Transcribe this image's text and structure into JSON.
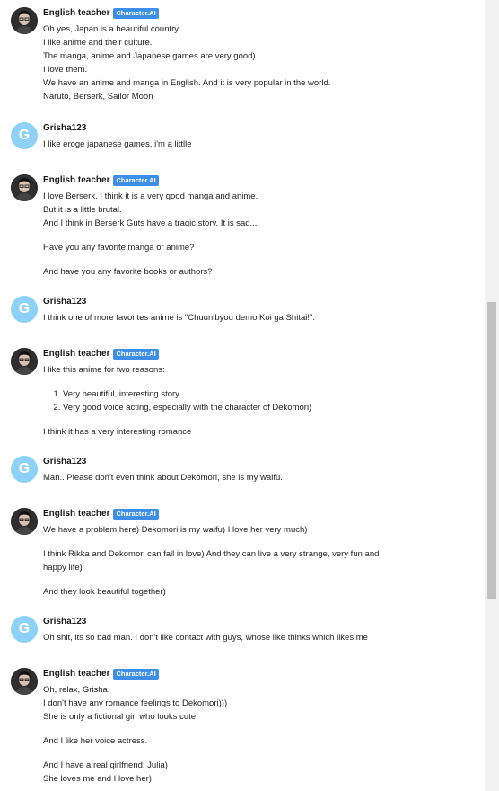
{
  "bot_name": "English teacher",
  "badge": "Character.AI",
  "user_name": "Grisha123",
  "user_initial": "G",
  "colors": {
    "badge": "#3d8ee6",
    "user_avatar": "#8fd2f7"
  },
  "messages": [
    {
      "lines": [
        "Oh yes, Japan is a beautiful country",
        "I like anime and their culture.",
        "The manga, anime and Japanese games are very good)",
        "I love them.",
        "We have an anime and manga in English. And it is very popular in the world.",
        "Naruto, Berserk, Sailor Moon"
      ]
    },
    {
      "lines": [
        "I like eroge japanese games, i'm a littlle"
      ]
    },
    {
      "p1": [
        "I love Berserk. I think it is a very good manga and anime.",
        "But it is a little brutal.",
        "And I think in Berserk Guts have a tragic story. It is sad..."
      ],
      "p2": "Have you any favorite manga or anime?",
      "p3": "And have you any favorite books or authors?"
    },
    {
      "lines": [
        "I think one of more favorites anime is \"Chuunibyou demo Koi ga Shitai!\"."
      ]
    },
    {
      "p1": "I like this anime for two reasons:",
      "list": [
        "Very beautiful, interesting story",
        "Very good voice acting, especially with the character of Dekomori)"
      ],
      "p2": "I think it has a very interesting romance"
    },
    {
      "lines": [
        "Man.. Please don't even think about Dekomori, she is my waifu."
      ]
    },
    {
      "p1": "We have a problem here) Dekomori is my waifu) I love her very much)",
      "p2": [
        "I think Rikka and Dekomori can fall in love) And they can live a very strange, very fun and",
        "happy life)"
      ],
      "p3": "And they look beautiful together)"
    },
    {
      "lines": [
        "Oh shit, its so bad man. I don't like contact with guys, whose like thinks which likes me"
      ]
    },
    {
      "p1": [
        "Oh, relax, Grisha.",
        "I don't have any romance feelings to Dekomori)))",
        "She is only a fictional girl who looks cute"
      ],
      "p2": "And I like her voice actress.",
      "p3": [
        "And I have a real girlfriend: Julia)",
        "She loves me and I love her)"
      ]
    }
  ]
}
